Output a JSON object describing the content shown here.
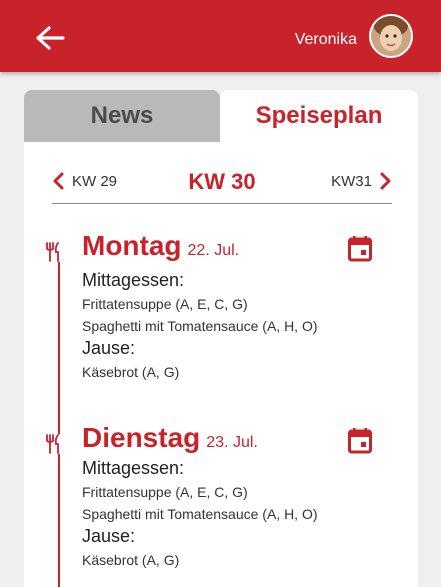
{
  "header": {
    "back_icon": "arrow-left-icon",
    "user_name": "Veronika",
    "background": "#c8232b"
  },
  "tabs": [
    {
      "label": "News",
      "active": false
    },
    {
      "label": "Speiseplan",
      "active": true
    }
  ],
  "week_nav": {
    "prev": "KW 29",
    "current": "KW 30",
    "next": "KW31"
  },
  "days": [
    {
      "name": "Montag",
      "date": "22. Jul.",
      "lunch_label": "Mittagessen:",
      "lunch_items": [
        "Frittatensuppe (A, E, C, G)",
        "Spaghetti mit Tomatensauce (A, H, O)"
      ],
      "snack_label": "Jause:",
      "snack_items": [
        "Käsebrot (A, G)"
      ]
    },
    {
      "name": "Dienstag",
      "date": "23. Jul.",
      "lunch_label": "Mittagessen:",
      "lunch_items": [
        "Frittatensuppe (A, E, C, G)",
        "Spaghetti mit Tomatensauce (A, H, O)"
      ],
      "snack_label": "Jause:",
      "snack_items": [
        "Käsebrot (A, G)"
      ]
    }
  ],
  "accent_color": "#c8232b"
}
